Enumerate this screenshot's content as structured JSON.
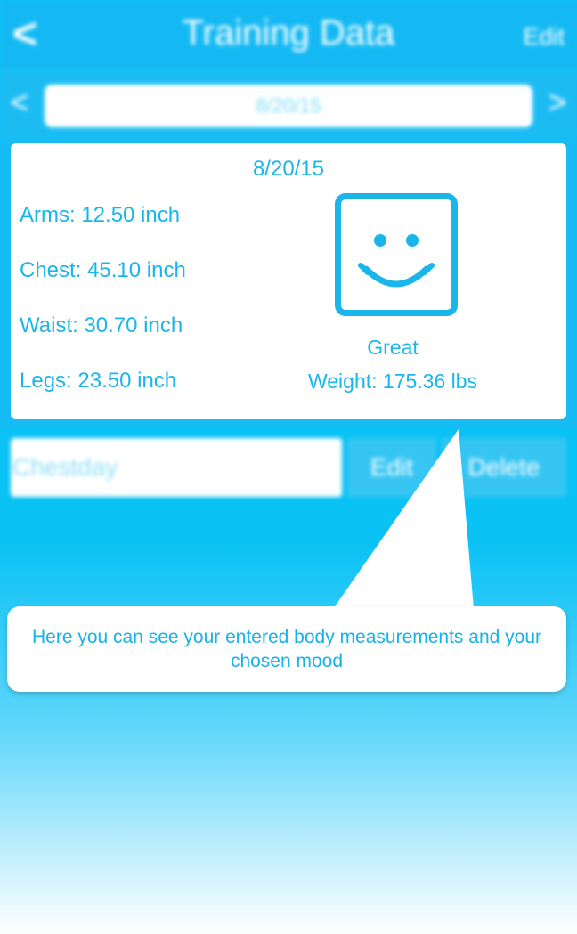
{
  "navbar": {
    "back_glyph": "<",
    "title": "Training Data",
    "edit_label": "Edit"
  },
  "date_selector": {
    "prev_glyph": "<",
    "next_glyph": ">",
    "current_date": "8/20/15"
  },
  "entry_card": {
    "date": "8/20/15",
    "measurements": [
      "Arms: 12.50 inch",
      "Chest: 45.10 inch",
      "Waist: 30.70 inch",
      "Legs: 23.50 inch"
    ],
    "mood_icon": "smiley-face-icon",
    "mood": "Great",
    "weight": "Weight: 175.36 lbs"
  },
  "workout_row": {
    "name": "Chestday",
    "edit_label": "Edit",
    "delete_label": "Delete"
  },
  "tooltip": {
    "text": "Here you can see your entered body measurements and your chosen mood"
  },
  "colors": {
    "accent": "#1ab6ea",
    "background": "#0bc2f5",
    "card": "#ffffff"
  }
}
